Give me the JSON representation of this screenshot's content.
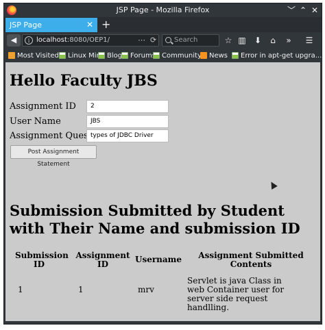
{
  "window": {
    "title": "JSP Page - Mozilla Firefox",
    "controls": [
      "﹀",
      "⌃",
      "✕"
    ]
  },
  "tab": {
    "title": "JSP Page",
    "close": "✕",
    "new_tab": "+"
  },
  "nav": {
    "url_host": "localhost",
    "url_rest": ":8080/OEP1/",
    "url_more": "⋯",
    "reload": "⟳",
    "search_placeholder": "Search",
    "icons": [
      "star-icon",
      "library-icon",
      "download-icon",
      "home-icon",
      "overflow-icon",
      "menu-icon"
    ]
  },
  "bookmarks": [
    {
      "label": "Most Visited",
      "icon": "folder-icon"
    },
    {
      "label": "Linux Mint",
      "icon": "page-icon"
    },
    {
      "label": "Blog",
      "icon": "page-icon"
    },
    {
      "label": "Forums",
      "icon": "page-icon"
    },
    {
      "label": "Community",
      "icon": "page-icon"
    },
    {
      "label": "News",
      "icon": "rss-icon"
    },
    {
      "label": "Error in apt-get upgra...",
      "icon": "page-icon"
    }
  ],
  "page": {
    "heading": "Hello Faculty JBS",
    "form": {
      "assignment_id": {
        "label": "Assignment ID",
        "value": "2"
      },
      "user_name": {
        "label": "User Name",
        "value": "JBS"
      },
      "assignment_question": {
        "label": "Assignment Question",
        "value": "types of JDBC Driver"
      },
      "submit_label": "Post Assignment Statement"
    },
    "submissions_heading": "Submission Submitted by Student with Their Name and submission ID",
    "table": {
      "headers": [
        "Submission ID",
        "Assignment ID",
        "Username",
        "Assignment Submitted Contents"
      ],
      "rows": [
        [
          "1",
          "1",
          "mrv",
          "Servlet is java Class in web Container user for server side request handlling."
        ]
      ]
    }
  }
}
